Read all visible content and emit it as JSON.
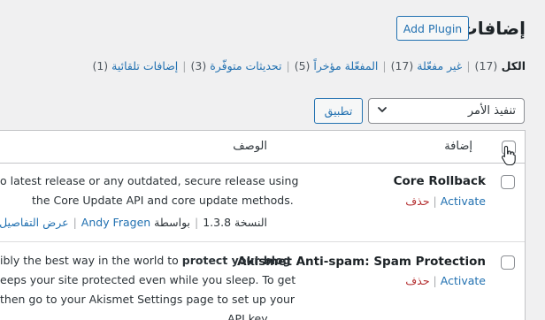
{
  "header": {
    "title": "إضافات",
    "add_button": "Add Plugin"
  },
  "filters": [
    {
      "label": "الكل",
      "count": "(17)",
      "current": true
    },
    {
      "label": "غير مفعّلة",
      "count": "(17)",
      "current": false
    },
    {
      "label": "المفعّلة مؤخراً",
      "count": "(5)",
      "current": false
    },
    {
      "label": "تحديثات متوفّرة",
      "count": "(3)",
      "current": false
    },
    {
      "label": "إضافات تلقائية",
      "count": "(1)",
      "current": false
    }
  ],
  "bulk": {
    "selected": "تنفيذ الأمر",
    "apply": "تطبيق"
  },
  "table": {
    "col_plugin": "إضافة",
    "col_description": "الوصف"
  },
  "plugins": [
    {
      "name": "Core Rollback",
      "activate": "Activate",
      "delete": "حذف",
      "description": [
        "o latest release or any outdated, secure release using",
        "the Core Update API and core update methods."
      ],
      "version": "النسخة 1.3.8",
      "by": "بواسطة",
      "author": "Andy Fragen",
      "details": "عرض التفاصيل"
    },
    {
      "name": "Akismet Anti-spam: Spam Protection",
      "activate": "Activate",
      "delete": "حذف",
      "description_lead": "ibly the best way in the world to ",
      "description_bold": "protect your blog",
      "description": [
        "eeps your site protected even while you sleep. To get",
        "then go to your Akismet Settings page to set up your",
        "API key."
      ]
    }
  ],
  "colors": {
    "link": "#2271b1",
    "delete": "#b32d2e",
    "background": "#f0f0f1"
  }
}
